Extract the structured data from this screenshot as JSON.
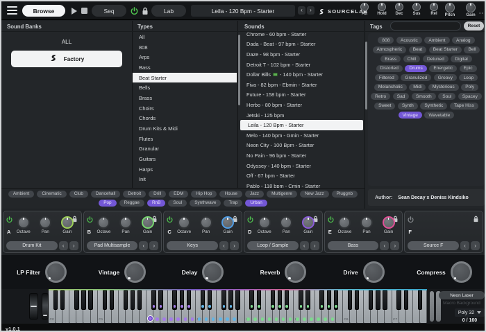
{
  "topbar": {
    "browse_label": "Browse",
    "seq_label": "Seq",
    "lab_label": "Lab",
    "preset_display": "Leila - 120 Bpm - Starter",
    "prev_label": "‹",
    "next_label": "›",
    "brand": "SOURCELAB",
    "env_knobs": [
      "Att",
      "Hold",
      "Dec",
      "Sus",
      "Rel"
    ],
    "perf_knobs": [
      "Pitch",
      "Gain"
    ],
    "meter_placeholder": "--"
  },
  "browser": {
    "banks": {
      "header": "Sound Banks",
      "items": [
        {
          "label": "ALL",
          "selected": false
        },
        {
          "label": "Factory",
          "selected": true,
          "icon": "sourcelab-logo"
        }
      ]
    },
    "types": {
      "header": "Types",
      "selected": "Beat Starter",
      "items": [
        "All",
        "808",
        "Arps",
        "Bass",
        "Beat Starter",
        "Bells",
        "Brass",
        "Choirs",
        "Chords",
        "Drum Kits & Midi",
        "Flutes",
        "Granular",
        "Guitars",
        "Harps",
        "Init"
      ]
    },
    "sounds": {
      "header": "Sounds",
      "items": [
        {
          "label": "Chrome - 60 bpm - Starter"
        },
        {
          "label": "Dada - Beat - 97 bpm - Starter"
        },
        {
          "label": "Daze - 98 bpm - Starter"
        },
        {
          "label": "Detroit T - 102 bpm - Starter"
        },
        {
          "label": "Dollar Bills",
          "suffix": " - 140 bpm - Starter",
          "icon": "money-icon"
        },
        {
          "label": "Fiva - 82 bpm - Ebmin - Starter"
        },
        {
          "label": "Future - 158 bpm - Starter"
        },
        {
          "label": "Herbo - 80 bpm - Starter"
        },
        {
          "label": "Jetski - 125 bpm"
        },
        {
          "label": "Leila - 120 Bpm - Starter",
          "selected": true
        },
        {
          "label": "Melo - 140 bpm - Gmin - Starter"
        },
        {
          "label": "Neon City - 100 Bpm - Starter"
        },
        {
          "label": "No Pain - 96 bpm - Starter"
        },
        {
          "label": "Odyssey - 140 bpm - Starter"
        },
        {
          "label": "Off - 67 bpm - Starter"
        },
        {
          "label": "Pablo - 118 bpm - Cmin - Starter"
        }
      ]
    },
    "tags": {
      "header": "Tags",
      "reset_label": "Reset",
      "search_placeholder": "",
      "items": [
        {
          "label": "808"
        },
        {
          "label": "Acoustic"
        },
        {
          "label": "Ambient"
        },
        {
          "label": "Analog"
        },
        {
          "label": "Atmospheric"
        },
        {
          "label": "Beat"
        },
        {
          "label": "Beat Starter"
        },
        {
          "label": "Bell"
        },
        {
          "label": "Brass"
        },
        {
          "label": "Chill"
        },
        {
          "label": "Detuned"
        },
        {
          "label": "Digital"
        },
        {
          "label": "Distorted"
        },
        {
          "label": "Drums",
          "selected": true
        },
        {
          "label": "Energetic"
        },
        {
          "label": "Epic"
        },
        {
          "label": "Filtered"
        },
        {
          "label": "Granulized"
        },
        {
          "label": "Groovy"
        },
        {
          "label": "Loop"
        },
        {
          "label": "Melancholic"
        },
        {
          "label": "Midi"
        },
        {
          "label": "Mysterious"
        },
        {
          "label": "Poly"
        },
        {
          "label": "Retro"
        },
        {
          "label": "Sad"
        },
        {
          "label": "Smooth"
        },
        {
          "label": "Soul"
        },
        {
          "label": "Spacey"
        },
        {
          "label": "Sweet"
        },
        {
          "label": "Synth"
        },
        {
          "label": "Synthetic"
        },
        {
          "label": "Tape Hiss"
        },
        {
          "label": "Vintage",
          "selected": true
        },
        {
          "label": "Wavetable"
        }
      ]
    },
    "genres": [
      {
        "label": "Ambient"
      },
      {
        "label": "Cinematic"
      },
      {
        "label": "Club"
      },
      {
        "label": "Dancehall"
      },
      {
        "label": "Detroit"
      },
      {
        "label": "Drill"
      },
      {
        "label": "EDM"
      },
      {
        "label": "Hip Hop"
      },
      {
        "label": "House"
      },
      {
        "label": "Jazz"
      },
      {
        "label": "Multigenre"
      },
      {
        "label": "New Jazz"
      },
      {
        "label": "Pluggnb"
      },
      {
        "label": "Pop",
        "selected": true
      },
      {
        "label": "Reggae"
      },
      {
        "label": "RnB",
        "selected": true
      },
      {
        "label": "Soul"
      },
      {
        "label": "Synthwave"
      },
      {
        "label": "Trap"
      },
      {
        "label": "Urban",
        "selected": true
      }
    ],
    "author_label": "Author:",
    "author_value": "Sean Decay x Deniss Kindsiko"
  },
  "sources": {
    "knob_labels": [
      "Octave",
      "Pan",
      "Gain"
    ],
    "slots": [
      {
        "letter": "A",
        "name": "Drum Kit",
        "enabled": true,
        "accent": "#9ccf57"
      },
      {
        "letter": "B",
        "name": "Pad Multisample",
        "enabled": true,
        "accent": "#76d56e"
      },
      {
        "letter": "C",
        "name": "Keys",
        "enabled": true,
        "accent": "#4f9ce4"
      },
      {
        "letter": "D",
        "name": "Loop / Sample",
        "enabled": true,
        "accent": "#8a5ad8"
      },
      {
        "letter": "E",
        "name": "Bass",
        "enabled": true,
        "accent": "#e04f96"
      },
      {
        "letter": "F",
        "name": "Source F",
        "enabled": false,
        "accent": ""
      }
    ]
  },
  "fx": {
    "knobs": [
      "LP Filter",
      "Vintage",
      "Delay",
      "Reverb",
      "Drive",
      "Compress"
    ]
  },
  "keyboard": {
    "octave_labels": [
      "C0",
      "C1",
      "C2",
      "C3",
      "C4",
      "C5",
      "C6",
      "C7"
    ],
    "zone_colors": {
      "purple": "#a37be8",
      "blue": "#62b4e4",
      "green": "#7ed98e"
    },
    "macro_button_label": "Neon Laser",
    "macro_caption": "Macro Background",
    "poly_label": "Poly 32",
    "voice_count": "0 / 160"
  },
  "particle_colors": [
    "#2fd4c3",
    "#9a5fd8",
    "#e0639c",
    "#5a48c8",
    "#49b8d8"
  ],
  "statusbar": {
    "version": "v1.0.1"
  }
}
